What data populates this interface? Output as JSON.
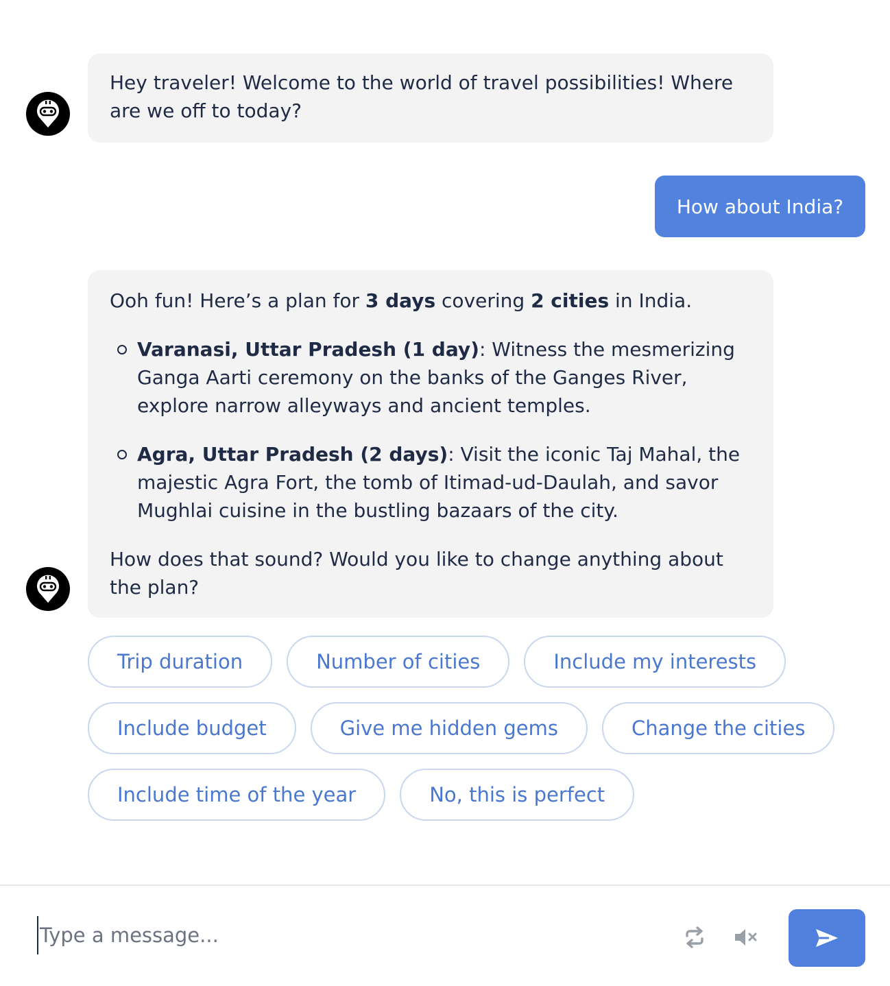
{
  "messages": {
    "greeting": "Hey traveler! Welcome to the world of travel possibilities! Where are we off to today?",
    "user_reply": "How about India?",
    "plan": {
      "intro_1": "Ooh fun! Here’s a plan for ",
      "intro_days": "3 days",
      "intro_2": " covering ",
      "intro_cities": "2 cities",
      "intro_3": " in India.",
      "items": [
        {
          "title": "Varanasi, Uttar Pradesh (1 day)",
          "text": ": Witness the mesmerizing Ganga Aarti ceremony on the banks of the Ganges River, explore narrow alleyways and ancient temples."
        },
        {
          "title": "Agra, Uttar Pradesh (2 days)",
          "text": ": Visit the iconic Taj Mahal, the majestic Agra Fort, the tomb of Itimad-ud-Daulah, and savor Mughlai cuisine in the bustling bazaars of the city."
        }
      ],
      "closing": "How does that sound? Would you like to change anything about the plan?"
    }
  },
  "suggestions": [
    "Trip duration",
    "Number of cities",
    "Include my interests",
    "Include budget",
    "Give me hidden gems",
    "Change the cities",
    "Include time of the year",
    "No, this is perfect"
  ],
  "composer": {
    "placeholder": "Type a message...",
    "value": ""
  },
  "icons": {
    "bot_avatar": "robot-pin-icon",
    "refresh": "refresh-icon",
    "mute": "mute-icon",
    "send": "send-icon"
  },
  "colors": {
    "accent": "#4f80de",
    "bot_bubble": "#f3f3f4",
    "chip_text": "#4a78d0",
    "chip_border": "#c9d6ef"
  }
}
